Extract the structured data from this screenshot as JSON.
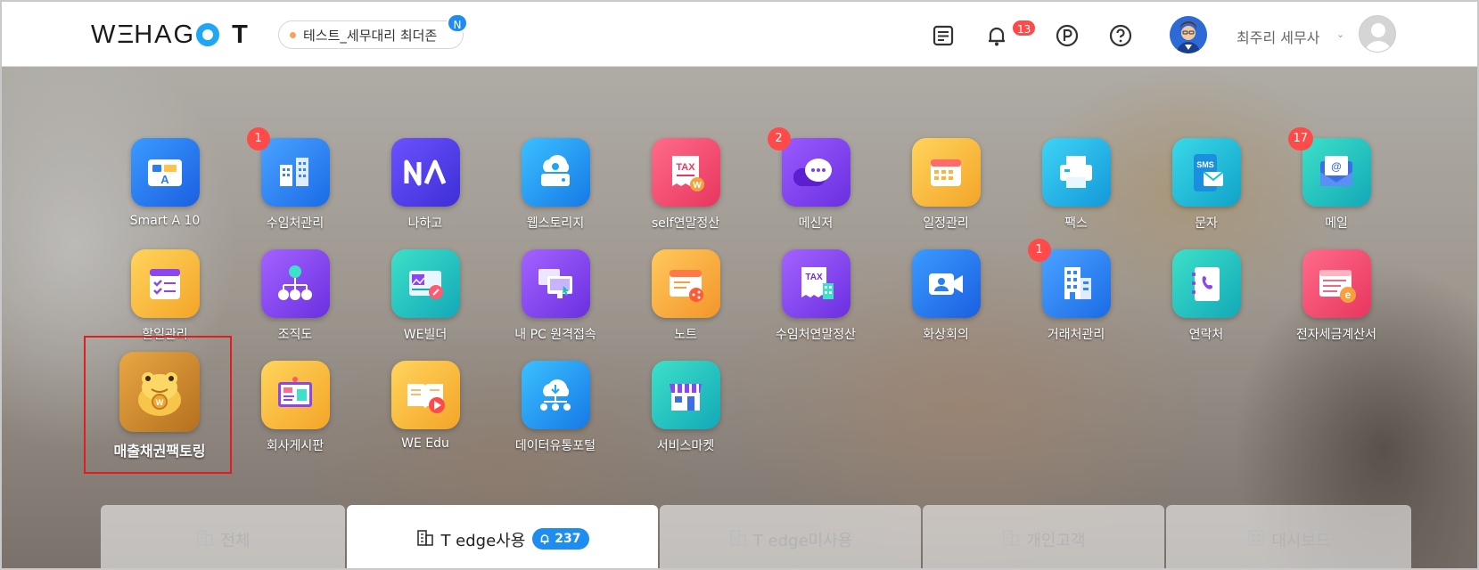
{
  "header": {
    "logo_text": "WEHAGO",
    "logo_suffix": "T",
    "company_name": "테스트_세무대리 최더존",
    "new_badge": "N",
    "notification_count": "13",
    "user_name": "최주리 세무사"
  },
  "apps": [
    {
      "label": "Smart A 10",
      "badge": "",
      "color": "#2a7ef0"
    },
    {
      "label": "수임처관리",
      "badge": "1",
      "color": "#2f86f5"
    },
    {
      "label": "나하고",
      "badge": "",
      "color": "#5a49ea"
    },
    {
      "label": "웹스토리지",
      "badge": "",
      "color": "#1fa6f0"
    },
    {
      "label": "self연말정산",
      "badge": "",
      "color": "#f0476f"
    },
    {
      "label": "메신저",
      "badge": "2",
      "color": "#7b3ff2"
    },
    {
      "label": "일정관리",
      "badge": "",
      "color": "#f6b73c"
    },
    {
      "label": "팩스",
      "badge": "",
      "color": "#19b7e8"
    },
    {
      "label": "문자",
      "badge": "",
      "color": "#15bfd8"
    },
    {
      "label": "메일",
      "badge": "17",
      "color": "#17c3c0"
    },
    {
      "label": "할일관리",
      "badge": "",
      "color": "#f6b73c"
    },
    {
      "label": "조직도",
      "badge": "",
      "color": "#8b46f0"
    },
    {
      "label": "WE빌더",
      "badge": "",
      "color": "#17c3b4"
    },
    {
      "label": "내 PC 원격접속",
      "badge": "",
      "color": "#8b46f0"
    },
    {
      "label": "노트",
      "badge": "",
      "color": "#f6a23c"
    },
    {
      "label": "수임처연말정산",
      "badge": "",
      "color": "#8b46f0"
    },
    {
      "label": "화상회의",
      "badge": "",
      "color": "#2a7ef0"
    },
    {
      "label": "거래처관리",
      "badge": "1",
      "color": "#2f86f5"
    },
    {
      "label": "연락처",
      "badge": "",
      "color": "#17c3b4"
    },
    {
      "label": "전자세금계산서",
      "badge": "",
      "color": "#f0476f"
    },
    {
      "label": "매출채권팩토링",
      "badge": "",
      "color": "#d08a2a"
    },
    {
      "label": "회사게시판",
      "badge": "",
      "color": "#f6b73c"
    },
    {
      "label": "WE Edu",
      "badge": "",
      "color": "#f6b73c"
    },
    {
      "label": "데이터유통포털",
      "badge": "",
      "color": "#1fa6f0"
    },
    {
      "label": "서비스마켓",
      "badge": "",
      "color": "#17c3b4"
    }
  ],
  "tabs": [
    {
      "label": "전체",
      "count": "",
      "active": false
    },
    {
      "label": "T edge사용",
      "count": "237",
      "active": true
    },
    {
      "label": "T edge미사용",
      "count": "",
      "active": false
    },
    {
      "label": "개인고객",
      "count": "",
      "active": false
    },
    {
      "label": "대시보드",
      "count": "",
      "active": false
    }
  ]
}
